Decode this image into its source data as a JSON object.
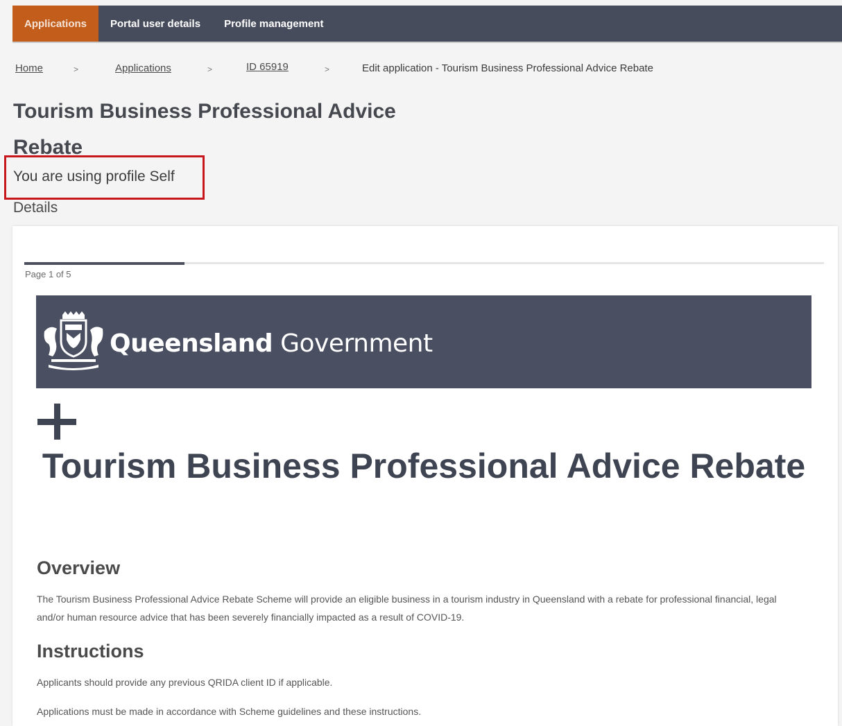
{
  "nav": {
    "items": [
      {
        "label": "Applications"
      },
      {
        "label": "Portal user details"
      },
      {
        "label": "Profile management"
      }
    ]
  },
  "breadcrumb": {
    "home": "Home",
    "applications": "Applications",
    "id": "ID 65919",
    "current": "Edit application - Tourism Business Professional Advice Rebate",
    "separator": ">"
  },
  "page": {
    "title": "Tourism Business Professional Advice Rebate",
    "profile_notice": "You are using profile Self",
    "details_label": "Details"
  },
  "form": {
    "progress_fraction": 0.2,
    "page_indicator": "Page 1 of 5",
    "banner_logo_bold": "Queensland",
    "banner_logo_regular": " Government",
    "heading": "Tourism Business Professional Advice Rebate",
    "overview_heading": "Overview",
    "overview_text": "The Tourism Business Professional Advice Rebate Scheme will provide an eligible business in a tourism industry in Queensland with a rebate for professional financial, legal and/or human resource advice that has been severely financially impacted as a result of COVID-19.",
    "instructions_heading": "Instructions",
    "instructions_1": "Applicants should provide any previous QRIDA client ID if applicable.",
    "instructions_2": "Applications must be made in accordance with Scheme guidelines and these instructions."
  },
  "colors": {
    "nav_bg": "#474c5c",
    "nav_active": "#c25d1b",
    "highlight_box": "#c8161d",
    "banner_bg": "#4a4f61"
  }
}
